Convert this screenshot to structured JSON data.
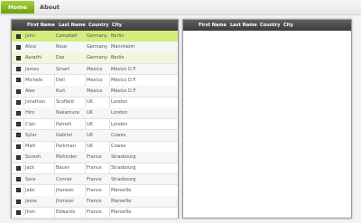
{
  "tabs": [
    {
      "label": "Home",
      "active": true
    },
    {
      "label": "About",
      "active": false
    }
  ],
  "left_grid": {
    "columns": [
      "First Name",
      "Last Name",
      "Country",
      "City"
    ],
    "rows": [
      {
        "first": "John",
        "last": "Campbell",
        "country": "Germany",
        "city": "Berlin",
        "state": "selected"
      },
      {
        "first": "Alice",
        "last": "Rose",
        "country": "Germany",
        "city": "Mannheim",
        "state": "normal"
      },
      {
        "first": "Aarathi",
        "last": "Das",
        "country": "Germany",
        "city": "Berlin",
        "state": "hover"
      },
      {
        "first": "James",
        "last": "Smart",
        "country": "Mexico",
        "city": "México D.F.",
        "state": "normal"
      },
      {
        "first": "Michele",
        "last": "Dell",
        "country": "Mexico",
        "city": "México D.F.",
        "state": "normal"
      },
      {
        "first": "Alex",
        "last": "Kurt",
        "country": "Mexico",
        "city": "México D.F.",
        "state": "normal"
      },
      {
        "first": "Jonathan",
        "last": "Scofield",
        "country": "UK",
        "city": "London",
        "state": "normal"
      },
      {
        "first": "Hiro",
        "last": "Nakamura",
        "country": "UK",
        "city": "London",
        "state": "normal"
      },
      {
        "first": "Clair",
        "last": "Patrelli",
        "country": "UK",
        "city": "London",
        "state": "normal"
      },
      {
        "first": "Sylar",
        "last": "Gabriel",
        "country": "UK",
        "city": "Cowes",
        "state": "normal"
      },
      {
        "first": "Matt",
        "last": "Parkman",
        "country": "UK",
        "city": "Cowes",
        "state": "normal"
      },
      {
        "first": "Suresh",
        "last": "Mohinder",
        "country": "France",
        "city": "Strasbourg",
        "state": "normal"
      },
      {
        "first": "Jack",
        "last": "Bauer",
        "country": "France",
        "city": "Strasbourg",
        "state": "normal"
      },
      {
        "first": "Sara",
        "last": "Conner",
        "country": "France",
        "city": "Strasbourg",
        "state": "normal"
      },
      {
        "first": "Jake",
        "last": "Jhonson",
        "country": "France",
        "city": "Marseille",
        "state": "normal"
      },
      {
        "first": "Jesse",
        "last": "Jhonson",
        "country": "France",
        "city": "Marseille",
        "state": "normal"
      },
      {
        "first": "Jhon",
        "last": "Edwards",
        "country": "France",
        "city": "Marseille",
        "state": "normal"
      }
    ]
  },
  "right_grid": {
    "columns": [
      "First Name",
      "Last Name",
      "Country",
      "City"
    ],
    "rows": []
  },
  "colors": {
    "accent": "#8dbb21",
    "selected_row": "#d4ec7e",
    "header_bg": "#4a4a4a"
  }
}
